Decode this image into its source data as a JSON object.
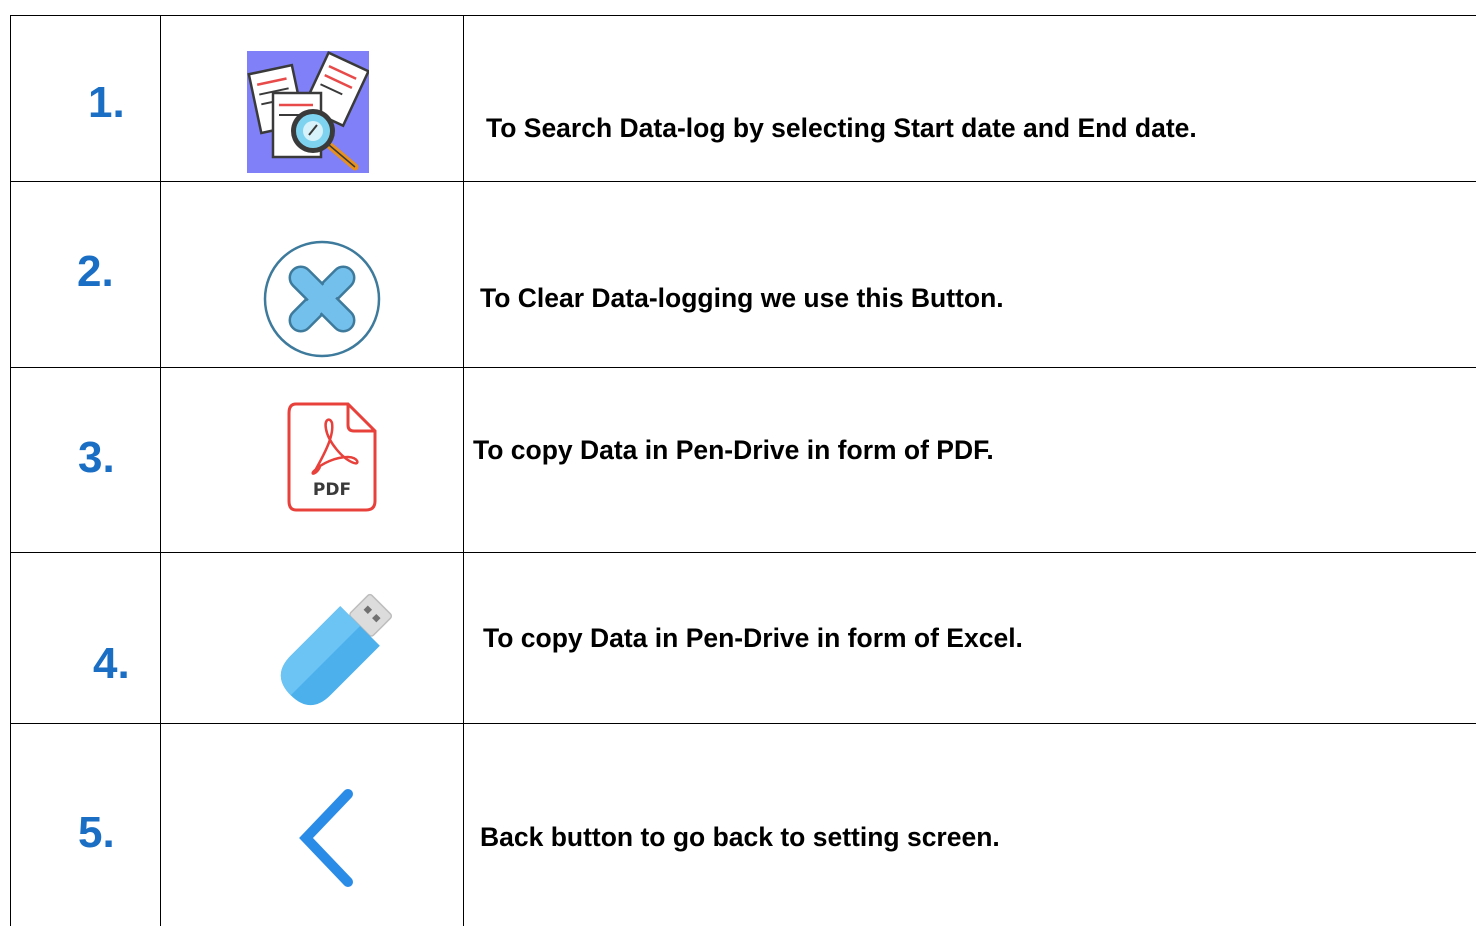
{
  "rows": [
    {
      "number": "1.",
      "icon": "search-data-log-icon",
      "description": "To Search Data-log by selecting Start date and End date."
    },
    {
      "number": "2.",
      "icon": "clear-x-circle-icon",
      "description": "To Clear Data-logging we use this Button."
    },
    {
      "number": "3.",
      "icon": "pdf-file-icon",
      "icon_text": "PDF",
      "description": "To copy Data in Pen-Drive in form of PDF."
    },
    {
      "number": "4.",
      "icon": "usb-pen-drive-icon",
      "description": "To copy Data in Pen-Drive in form of Excel."
    },
    {
      "number": "5.",
      "icon": "back-chevron-icon",
      "description": "Back button to go back to setting screen."
    }
  ],
  "colors": {
    "number": "#1a6ec4",
    "search_icon_bg": "#8080f8",
    "clear_icon": "#74c0ec",
    "clear_ring": "#3d7a9c",
    "pdf_red": "#e8403a",
    "usb_blue": "#4cb0ec",
    "back_blue": "#2b8ce8"
  }
}
